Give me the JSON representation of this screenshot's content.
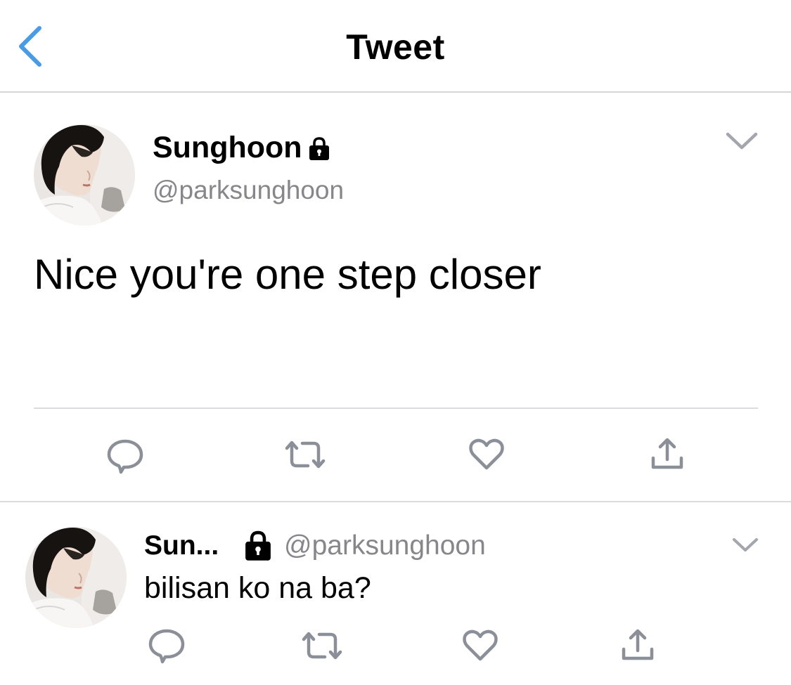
{
  "nav": {
    "title": "Tweet",
    "back_icon": "chevron-left-icon",
    "accent_color": "#4a9be6"
  },
  "tweet": {
    "author": {
      "display_name": "Sunghoon",
      "handle": "@parksunghoon",
      "protected_icon": "lock-icon"
    },
    "text": "Nice you're one step closer",
    "menu_icon": "chevron-down-icon",
    "actions": [
      "reply-icon",
      "retweet-icon",
      "like-icon",
      "share-icon"
    ]
  },
  "reply": {
    "author": {
      "display_name": "Sun...",
      "handle": "@parksunghoon",
      "protected_icon": "lock-icon"
    },
    "text": "bilisan ko na ba?",
    "menu_icon": "chevron-down-icon",
    "actions": [
      "reply-icon",
      "retweet-icon",
      "like-icon",
      "share-icon"
    ]
  },
  "colors": {
    "text": "#000000",
    "secondary_text": "#86868b",
    "icon_gray": "#8a8f98",
    "divider": "#dcdce0"
  }
}
